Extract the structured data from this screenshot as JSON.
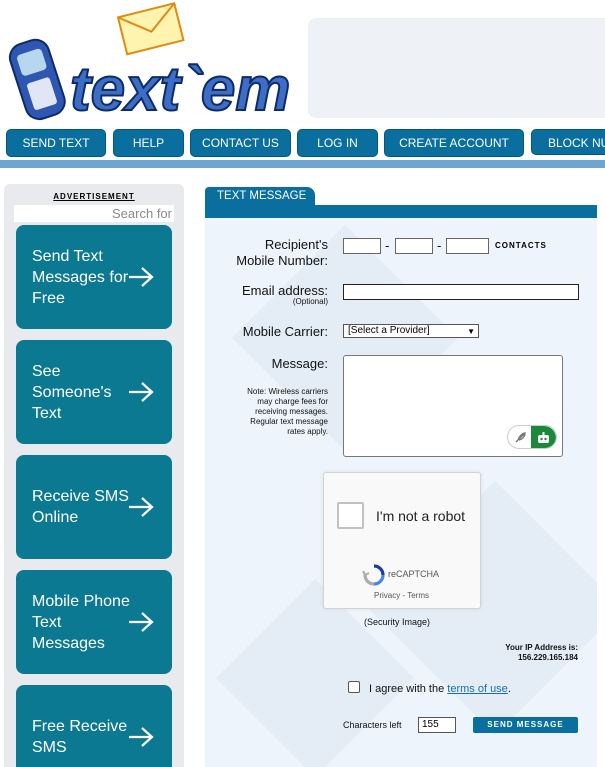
{
  "logo": {
    "text": "text`em"
  },
  "nav": {
    "items": [
      "SEND TEXT",
      "HELP",
      "CONTACT US",
      "LOG IN",
      "CREATE ACCOUNT",
      "BLOCK NU"
    ]
  },
  "sidebar": {
    "ad_label": "ADVERTISEMENT",
    "search_placeholder": "Search for",
    "cards": [
      "Send Text Messages for Free",
      "See Someone's Text",
      "Receive SMS Online",
      "Mobile Phone Text Messages",
      "Free Receive SMS"
    ]
  },
  "form": {
    "tab": "TEXT MESSAGE",
    "recipient_label_1": "Recipient's",
    "recipient_label_2": "Mobile Number:",
    "dash": "-",
    "contacts": "CONTACTS",
    "email_label": "Email address:",
    "email_optional": "(Optional)",
    "carrier_label": "Mobile Carrier:",
    "carrier_selected": "[Select a Provider]",
    "message_label": "Message:",
    "note_lines": [
      "Note: Wireless carriers",
      "may charge fees for",
      "receiving messages.",
      "Regular text message",
      "rates apply."
    ],
    "captcha_text": "I'm not a robot",
    "captcha_brand": "reCAPTCHA",
    "captcha_privacy": "Privacy",
    "captcha_sep": " - ",
    "captcha_terms": "Terms",
    "security_image": "(Security Image)",
    "ip_label": "Your IP Address is:",
    "ip_value": "156.229.165.184",
    "agree_prefix": "I agree with the ",
    "agree_link": "terms of use",
    "agree_suffix": ".",
    "chars_label": "Characters left",
    "chars_value": "155",
    "send_label": "SEND MESSAGE"
  }
}
